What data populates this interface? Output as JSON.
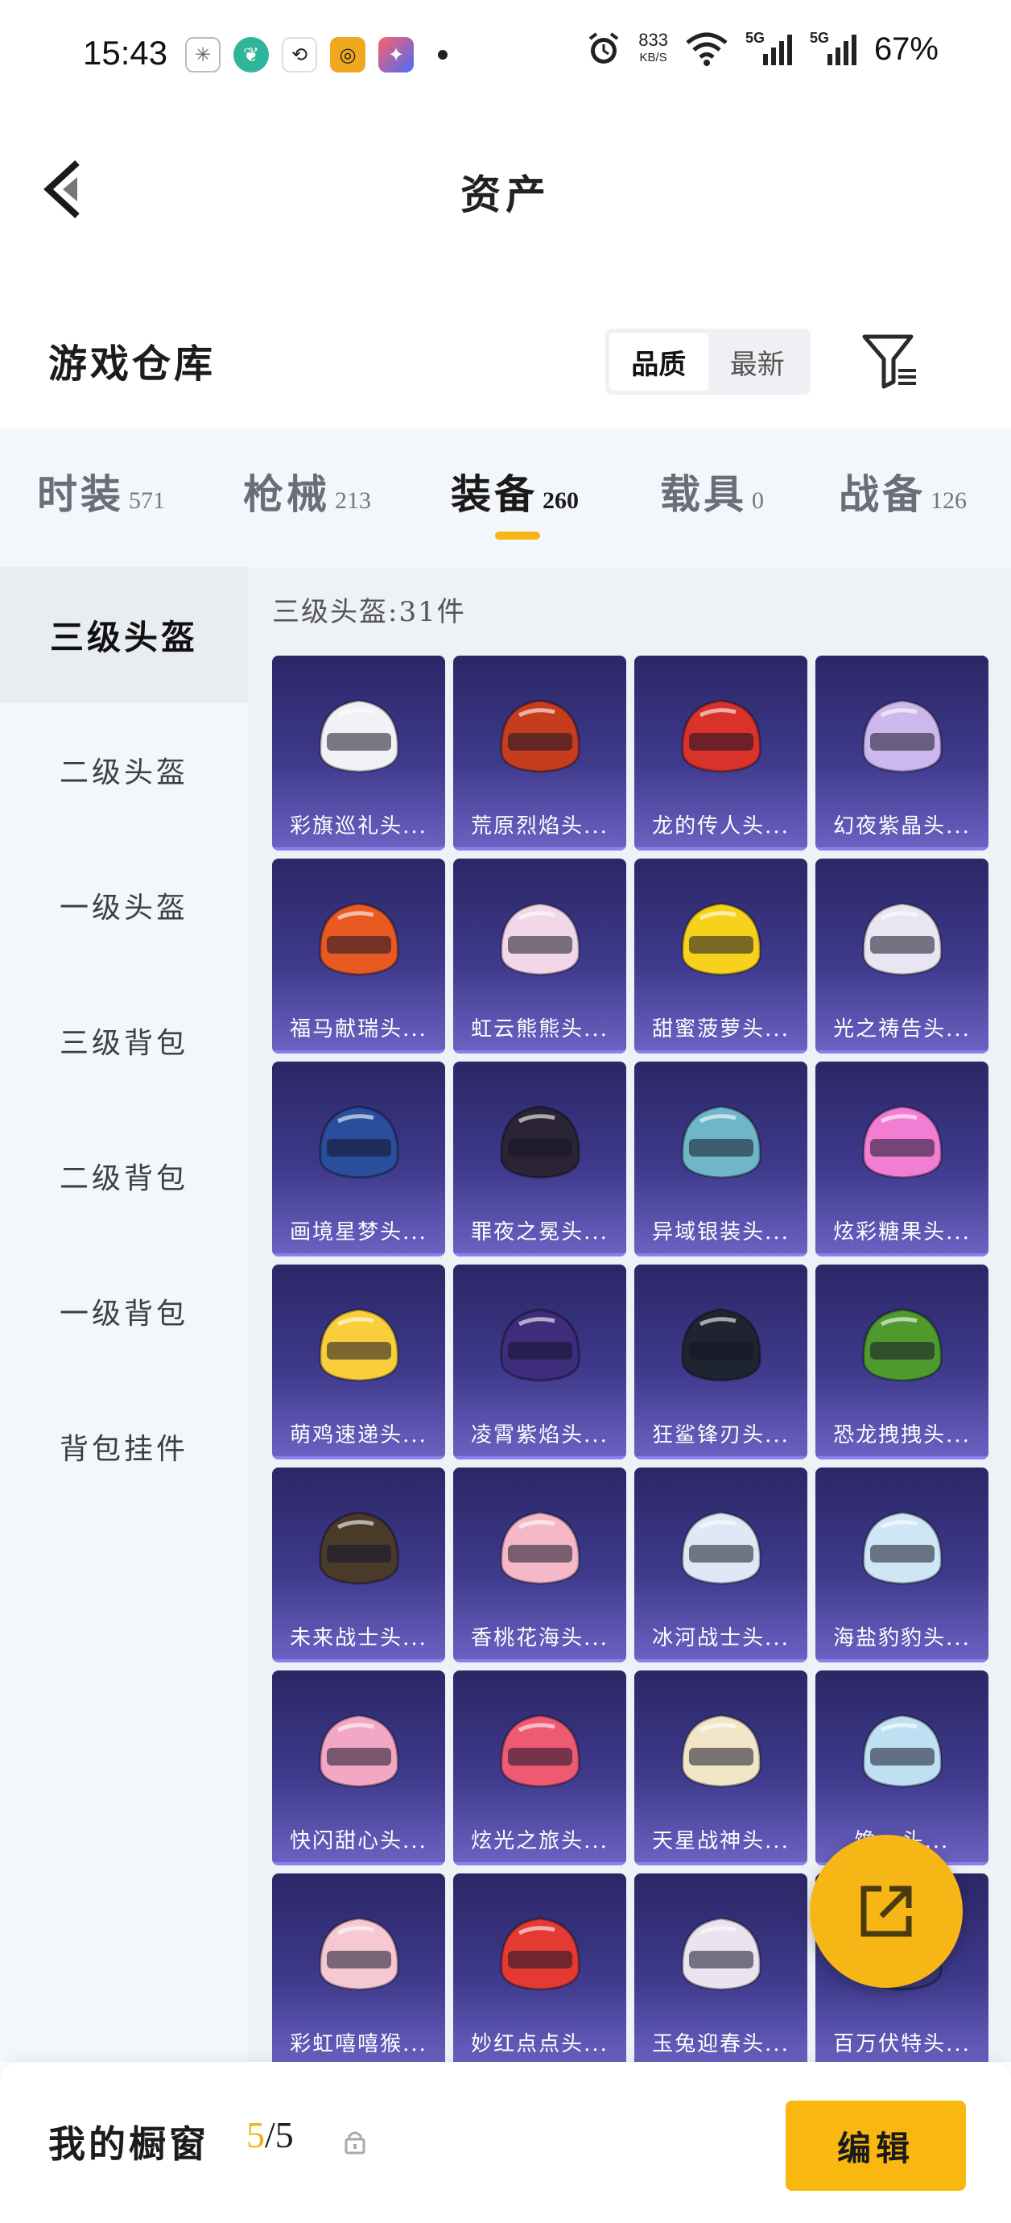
{
  "status_bar": {
    "time": "15:43",
    "net_speed": "833",
    "net_unit": "KB/S",
    "signal1": "5G",
    "signal2": "5G",
    "battery": "67%"
  },
  "header": {
    "title": "资产"
  },
  "warehouse": {
    "title": "游戏仓库",
    "sort_options": [
      "品质",
      "最新"
    ],
    "active_sort": "品质"
  },
  "tabs": [
    {
      "label": "时装",
      "count": "571"
    },
    {
      "label": "枪械",
      "count": "213"
    },
    {
      "label": "装备",
      "count": "260"
    },
    {
      "label": "载具",
      "count": "0"
    },
    {
      "label": "战备",
      "count": "126"
    }
  ],
  "active_tab": "装备",
  "sidebar": {
    "items": [
      "三级头盔",
      "二级头盔",
      "一级头盔",
      "三级背包",
      "二级背包",
      "一级背包",
      "背包挂件"
    ],
    "active": "三级头盔"
  },
  "content": {
    "count_line": "三级头盔:31件",
    "items": [
      {
        "name": "彩旗巡礼头...",
        "color": "#f1f1f6"
      },
      {
        "name": "荒原烈焰头...",
        "color": "#c63d1e"
      },
      {
        "name": "龙的传人头...",
        "color": "#d8322b"
      },
      {
        "name": "幻夜紫晶头...",
        "color": "#cdb8ee"
      },
      {
        "name": "福马献瑞头...",
        "color": "#e85a22"
      },
      {
        "name": "虹云熊熊头...",
        "color": "#f2d7e8"
      },
      {
        "name": "甜蜜菠萝头...",
        "color": "#f7d21d"
      },
      {
        "name": "光之祷告头...",
        "color": "#e9e6f2"
      },
      {
        "name": "画境星梦头...",
        "color": "#2a4d9c"
      },
      {
        "name": "罪夜之冕头...",
        "color": "#2b2434"
      },
      {
        "name": "异域银装头...",
        "color": "#6fb6c8"
      },
      {
        "name": "炫彩糖果头...",
        "color": "#f27ed3"
      },
      {
        "name": "萌鸡速递头...",
        "color": "#f8cf3a"
      },
      {
        "name": "凌霄紫焰头...",
        "color": "#3d2d7a"
      },
      {
        "name": "狂鲨锋刃头...",
        "color": "#1f2530"
      },
      {
        "name": "恐龙拽拽头...",
        "color": "#4e9a2d"
      },
      {
        "name": "未来战士头...",
        "color": "#4a3a2a"
      },
      {
        "name": "香桃花海头...",
        "color": "#f4b8c8"
      },
      {
        "name": "冰河战士头...",
        "color": "#dfe9f6"
      },
      {
        "name": "海盐豹豹头...",
        "color": "#cfe6f4"
      },
      {
        "name": "快闪甜心头...",
        "color": "#f2a7c4"
      },
      {
        "name": "炫光之旅头...",
        "color": "#ee5a72"
      },
      {
        "name": "天星战神头...",
        "color": "#f1e7c8"
      },
      {
        "name": "馋...头...",
        "color": "#bfe0f2"
      },
      {
        "name": "彩虹嘻嘻猴...",
        "color": "#f5c8d4"
      },
      {
        "name": "妙红点点头...",
        "color": "#e33a34"
      },
      {
        "name": "玉兔迎春头...",
        "color": "#e9e4ee"
      },
      {
        "name": "百万伏特头...",
        "color": "#3d3a80"
      }
    ]
  },
  "bottom_bar": {
    "showcase_label": "我的橱窗",
    "showcase_current": "5",
    "showcase_total": "/5",
    "edit_label": "编辑"
  },
  "colors": {
    "accent": "#f6b716",
    "card_bg": "#3f3a8c"
  }
}
